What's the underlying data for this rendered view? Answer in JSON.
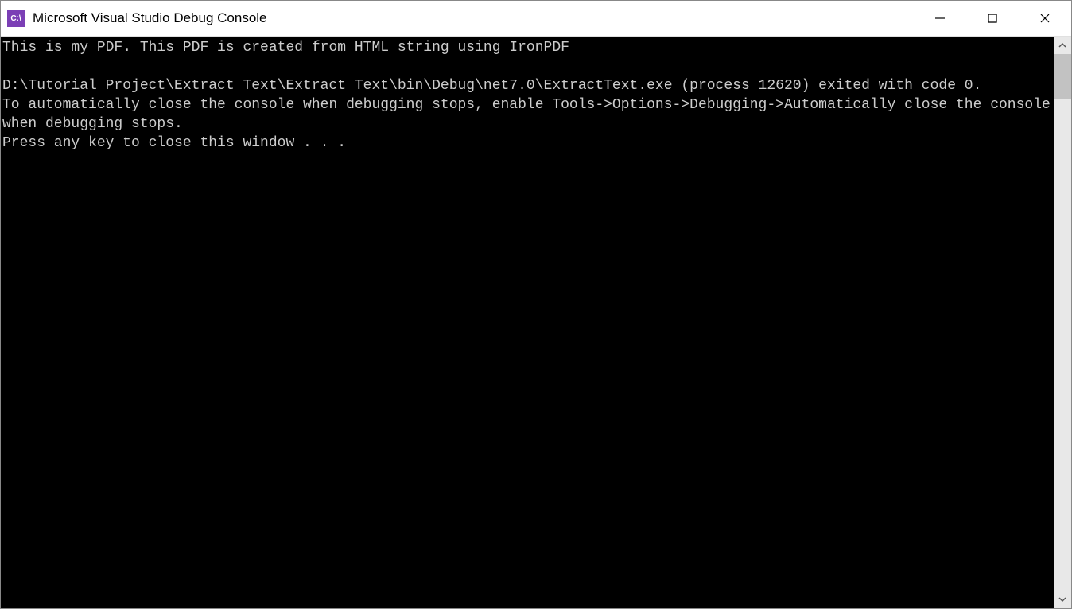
{
  "window": {
    "title": "Microsoft Visual Studio Debug Console",
    "icon_label": "C:\\"
  },
  "console": {
    "lines": [
      "This is my PDF. This PDF is created from HTML string using IronPDF",
      "",
      "D:\\Tutorial Project\\Extract Text\\Extract Text\\bin\\Debug\\net7.0\\ExtractText.exe (process 12620) exited with code 0.",
      "To automatically close the console when debugging stops, enable Tools->Options->Debugging->Automatically close the console when debugging stops.",
      "Press any key to close this window . . ."
    ]
  },
  "colors": {
    "titlebar_bg": "#ffffff",
    "console_bg": "#000000",
    "console_fg": "#cccccc",
    "icon_bg": "#7b3fb5",
    "scrollbar_track": "#e8e8e8",
    "scrollbar_thumb": "#c2c2c2"
  }
}
